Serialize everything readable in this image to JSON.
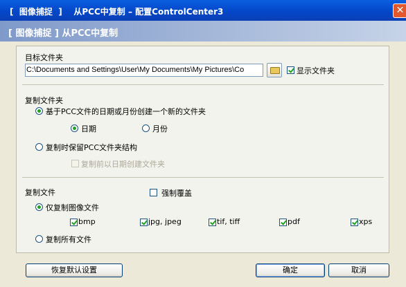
{
  "window": {
    "title": "[  图像捕捉  ]    从PCC中复制 – 配置ControlCenter3",
    "close_glyph": "✕"
  },
  "header": {
    "title": "[ 图像捕捉 ] 从PCC中复制"
  },
  "target_folder": {
    "label": "目标文件夹",
    "path": "C:\\Documents and Settings\\User\\My Documents\\My Pictures\\Co",
    "show_folder_label": "显示文件夹",
    "show_folder_checked": true
  },
  "copy_folder": {
    "label": "复制文件夹",
    "option_create_new": "基于PCC文件的日期或月份创建一个新的文件夹",
    "option_date": "日期",
    "option_month": "月份",
    "option_keep_structure": "复制时保留PCC文件夹结构",
    "option_create_by_date": "复制前以日期创建文件夹"
  },
  "copy_files": {
    "label": "复制文件",
    "force_overwrite_label": "强制覆盖",
    "option_images_only": "仅复制图像文件",
    "file_types": [
      "bmp",
      "jpg, jpeg",
      "tif, tiff",
      "pdf",
      "xps"
    ],
    "option_all_files": "复制所有文件"
  },
  "buttons": {
    "restore_defaults": "恢复默认设置",
    "ok": "确定",
    "cancel": "取消"
  }
}
